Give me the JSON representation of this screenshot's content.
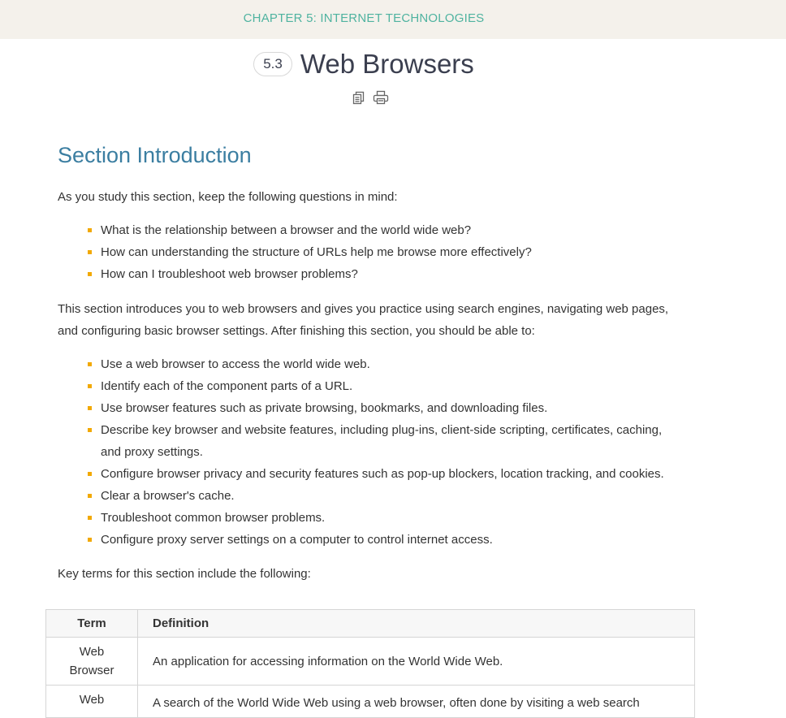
{
  "header": {
    "chapter": "CHAPTER 5: INTERNET TECHNOLOGIES",
    "section_number": "5.3",
    "title": "Web Browsers",
    "tools": [
      {
        "icon": "copy-icon"
      },
      {
        "icon": "print-icon"
      }
    ]
  },
  "intro": {
    "heading": "Section Introduction",
    "lead": "As you study this section, keep the following questions in mind:",
    "questions": [
      "What is the relationship between a browser and the world wide web?",
      "How can understanding the structure of URLs help me browse more effectively?",
      "How can I troubleshoot web browser problems?"
    ],
    "overview": "This section introduces you to web browsers and gives you practice using search engines, navigating web pages, and configuring basic browser settings. After finishing this section, you should be able to:",
    "objectives": [
      "Use a web browser to access the world wide web.",
      "Identify each of the component parts of a URL.",
      "Use browser features such as private browsing, bookmarks, and downloading files.",
      "Describe key browser and website features, including plug-ins, client-side scripting, certificates, caching, and proxy settings.",
      "Configure browser privacy and security features such as pop-up blockers, location tracking, and cookies.",
      "Clear a browser's cache.",
      "Troubleshoot common browser problems.",
      "Configure proxy server settings on a computer to control internet access."
    ],
    "key_terms_lead": "Key terms for this section include the following:"
  },
  "terms_table": {
    "headers": [
      "Term",
      "Definition"
    ],
    "rows": [
      {
        "term": "Web Browser",
        "definition": "An application for accessing information on the World Wide Web."
      },
      {
        "term": "Web",
        "definition": "A search of the World Wide Web using a web browser, often done by visiting a web search"
      }
    ]
  },
  "colors": {
    "chapter": "#4fb3a0",
    "heading": "#3b7ea1",
    "bullet": "#f2a900",
    "topbar": "#f4f1eb"
  }
}
